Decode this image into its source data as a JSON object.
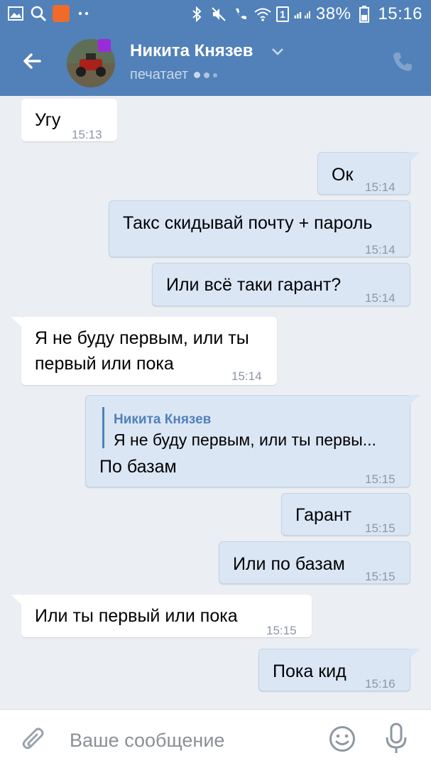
{
  "colors": {
    "header_bg": "#5181b8",
    "chat_bg": "#ebeef3",
    "bubble_in": "#ffffff",
    "bubble_out": "#dbe6f5",
    "accent": "#5181b8",
    "time_text": "#8d96a3"
  },
  "status_bar": {
    "battery_percent": "38%",
    "time": "15:16",
    "sim_label": "1",
    "left_icons": [
      "gallery-icon",
      "search-icon",
      "app-notification-icon",
      "more-dots-icon"
    ],
    "right_icons": [
      "bluetooth-icon",
      "mute-icon",
      "wifi-calling-icon",
      "wifi-icon",
      "sim-icon",
      "signal-icon",
      "battery-icon"
    ]
  },
  "header": {
    "contact_name": "Никита Князев",
    "status": "печатает",
    "icons": [
      "back-arrow-icon",
      "chevron-down-icon",
      "phone-icon"
    ]
  },
  "messages": [
    {
      "direction": "in",
      "text": "Угу",
      "time": "15:13"
    },
    {
      "direction": "out",
      "text": "Ок",
      "time": "15:14"
    },
    {
      "direction": "out",
      "text": "Такс скидывай почту + пароль",
      "time": "15:14"
    },
    {
      "direction": "out",
      "text": "Или всё таки гарант?",
      "time": "15:14"
    },
    {
      "direction": "in",
      "text_lines": [
        "Я не буду первым, или ты",
        "первый или пока"
      ],
      "time": "15:14"
    },
    {
      "direction": "out",
      "reply_author": "Никита Князев",
      "reply_text": "Я не буду первым, или ты первы...",
      "text": "По базам",
      "time": "15:15"
    },
    {
      "direction": "out",
      "text": "Гарант",
      "time": "15:15"
    },
    {
      "direction": "out",
      "text": "Или по базам",
      "time": "15:15"
    },
    {
      "direction": "in",
      "text": "Или ты первый или пока",
      "time": "15:15"
    },
    {
      "direction": "out",
      "text": "Пока кид",
      "time": "15:16"
    }
  ],
  "composer": {
    "placeholder": "Ваше сообщение",
    "icons": [
      "attach-icon",
      "emoji-icon",
      "microphone-icon"
    ]
  }
}
